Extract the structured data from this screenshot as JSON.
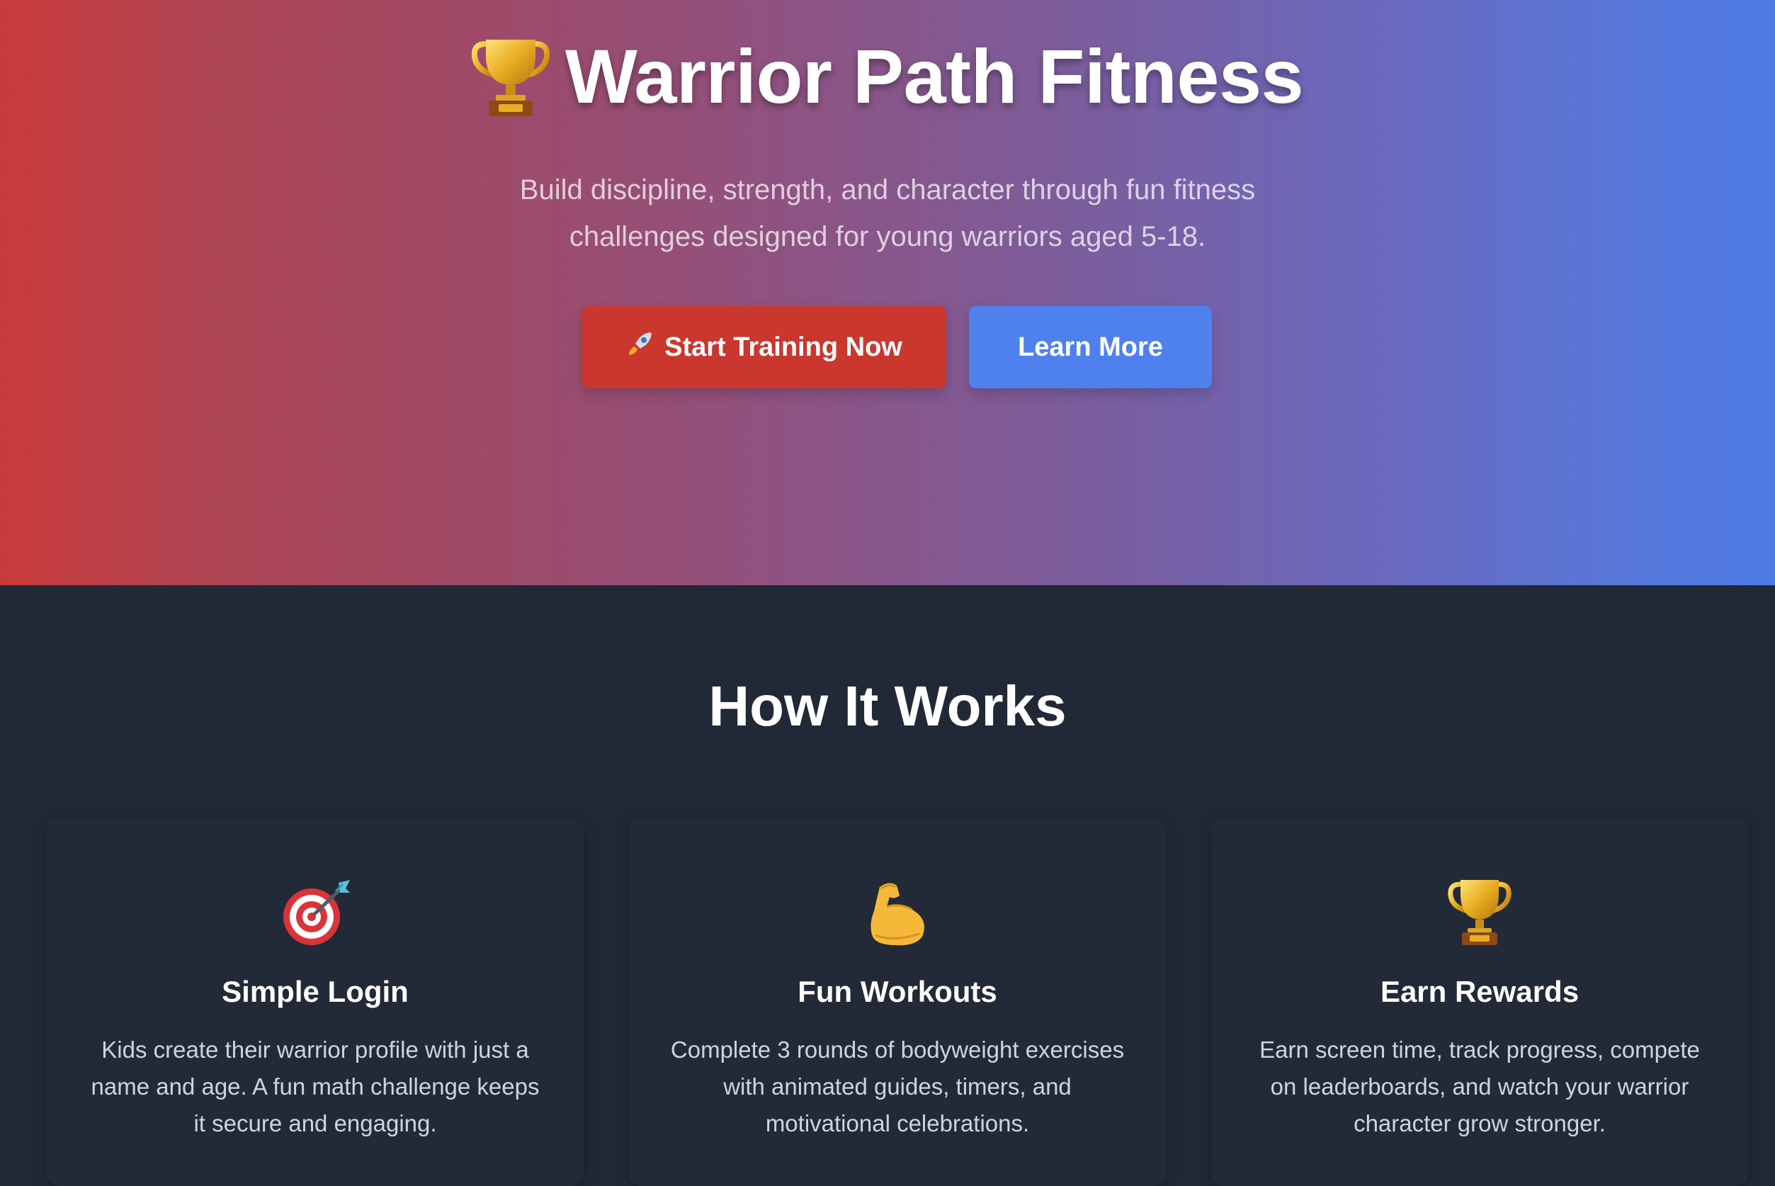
{
  "hero": {
    "title": "Warrior Path Fitness",
    "title_icon": "trophy-icon",
    "subtitle": "Build discipline, strength, and character through fun fitness challenges designed for young warriors aged 5-18.",
    "primary_button": {
      "icon": "rocket-icon",
      "label": "Start Training Now"
    },
    "secondary_button": {
      "label": "Learn More"
    }
  },
  "how_it_works": {
    "title": "How It Works",
    "cards": [
      {
        "icon": "target-icon",
        "title": "Simple Login",
        "text": "Kids create their warrior profile with just a name and age. A fun math challenge keeps it secure and engaging."
      },
      {
        "icon": "flexed-biceps-icon",
        "title": "Fun Workouts",
        "text": "Complete 3 rounds of bodyweight exercises with animated guides, timers, and motivational celebrations."
      },
      {
        "icon": "trophy-icon",
        "title": "Earn Rewards",
        "text": "Earn screen time, track progress, compete on leaderboards, and watch your warrior character grow stronger."
      }
    ]
  },
  "colors": {
    "hero_gradient_start": "#c93a3a",
    "hero_gradient_end": "#4f7be6",
    "primary_button": "#c9372f",
    "secondary_button": "#4f81ee",
    "page_background": "#222936"
  }
}
